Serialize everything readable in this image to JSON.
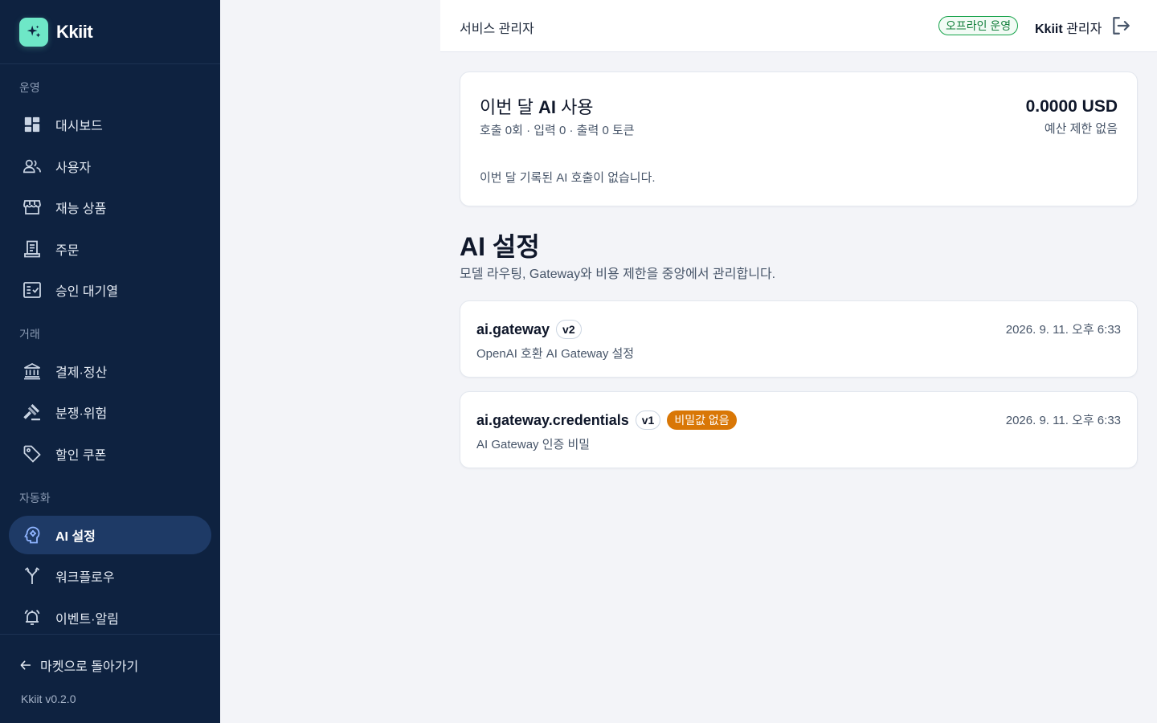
{
  "brand": {
    "name": "Kkiit"
  },
  "sidebar": {
    "sections": [
      {
        "label": "운영",
        "items": [
          {
            "label": "대시보드",
            "icon": "dashboard-icon"
          },
          {
            "label": "사용자",
            "icon": "users-icon"
          },
          {
            "label": "재능 상품",
            "icon": "storefront-icon"
          },
          {
            "label": "주문",
            "icon": "receipt-icon"
          },
          {
            "label": "승인 대기열",
            "icon": "approval-list-icon"
          }
        ]
      },
      {
        "label": "거래",
        "items": [
          {
            "label": "결제·정산",
            "icon": "bank-icon"
          },
          {
            "label": "분쟁·위험",
            "icon": "gavel-icon"
          },
          {
            "label": "할인 쿠폰",
            "icon": "tag-icon"
          }
        ]
      },
      {
        "label": "자동화",
        "items": [
          {
            "label": "AI 설정",
            "icon": "ai-brain-icon",
            "active": true
          },
          {
            "label": "워크플로우",
            "icon": "workflow-icon"
          },
          {
            "label": "이벤트·알림",
            "icon": "alarm-bell-icon"
          }
        ]
      }
    ],
    "back_label": "마켓으로 돌아가기",
    "version": "Kkiit v0.2.0"
  },
  "topbar": {
    "title": "서비스 관리자",
    "status": "오프라인 운영",
    "user_brand": "Kkiit",
    "user_role": "관리자"
  },
  "usage": {
    "title_prefix": "이번 달 ",
    "title_bold": "AI",
    "title_suffix": " 사용",
    "summary": "호출 0회 · 입력 0 · 출력 0 토큰",
    "amount": "0.0000 USD",
    "budget": "예산 제한 없음",
    "empty": "이번 달 기록된 AI 호출이 없습니다."
  },
  "page": {
    "title_bold": "AI",
    "title_rest": " 설정",
    "description": "모델 라우팅, Gateway와 비용 제한을 중앙에서 관리합니다."
  },
  "settings": [
    {
      "name": "ai.gateway",
      "version": "v2",
      "warning": "",
      "description": "OpenAI 호환 AI Gateway 설정",
      "date": "2026. 9. 11. 오후 6:33"
    },
    {
      "name": "ai.gateway.credentials",
      "version": "v1",
      "warning": "비밀값 없음",
      "description": "AI Gateway 인증 비밀",
      "date": "2026. 9. 11. 오후 6:33"
    }
  ],
  "colors": {
    "sidebar_bg": "#0e2240",
    "active_bg": "#1e3a66",
    "accent": "#6ee7c7",
    "warning": "#d97706",
    "success": "#16a34a"
  }
}
